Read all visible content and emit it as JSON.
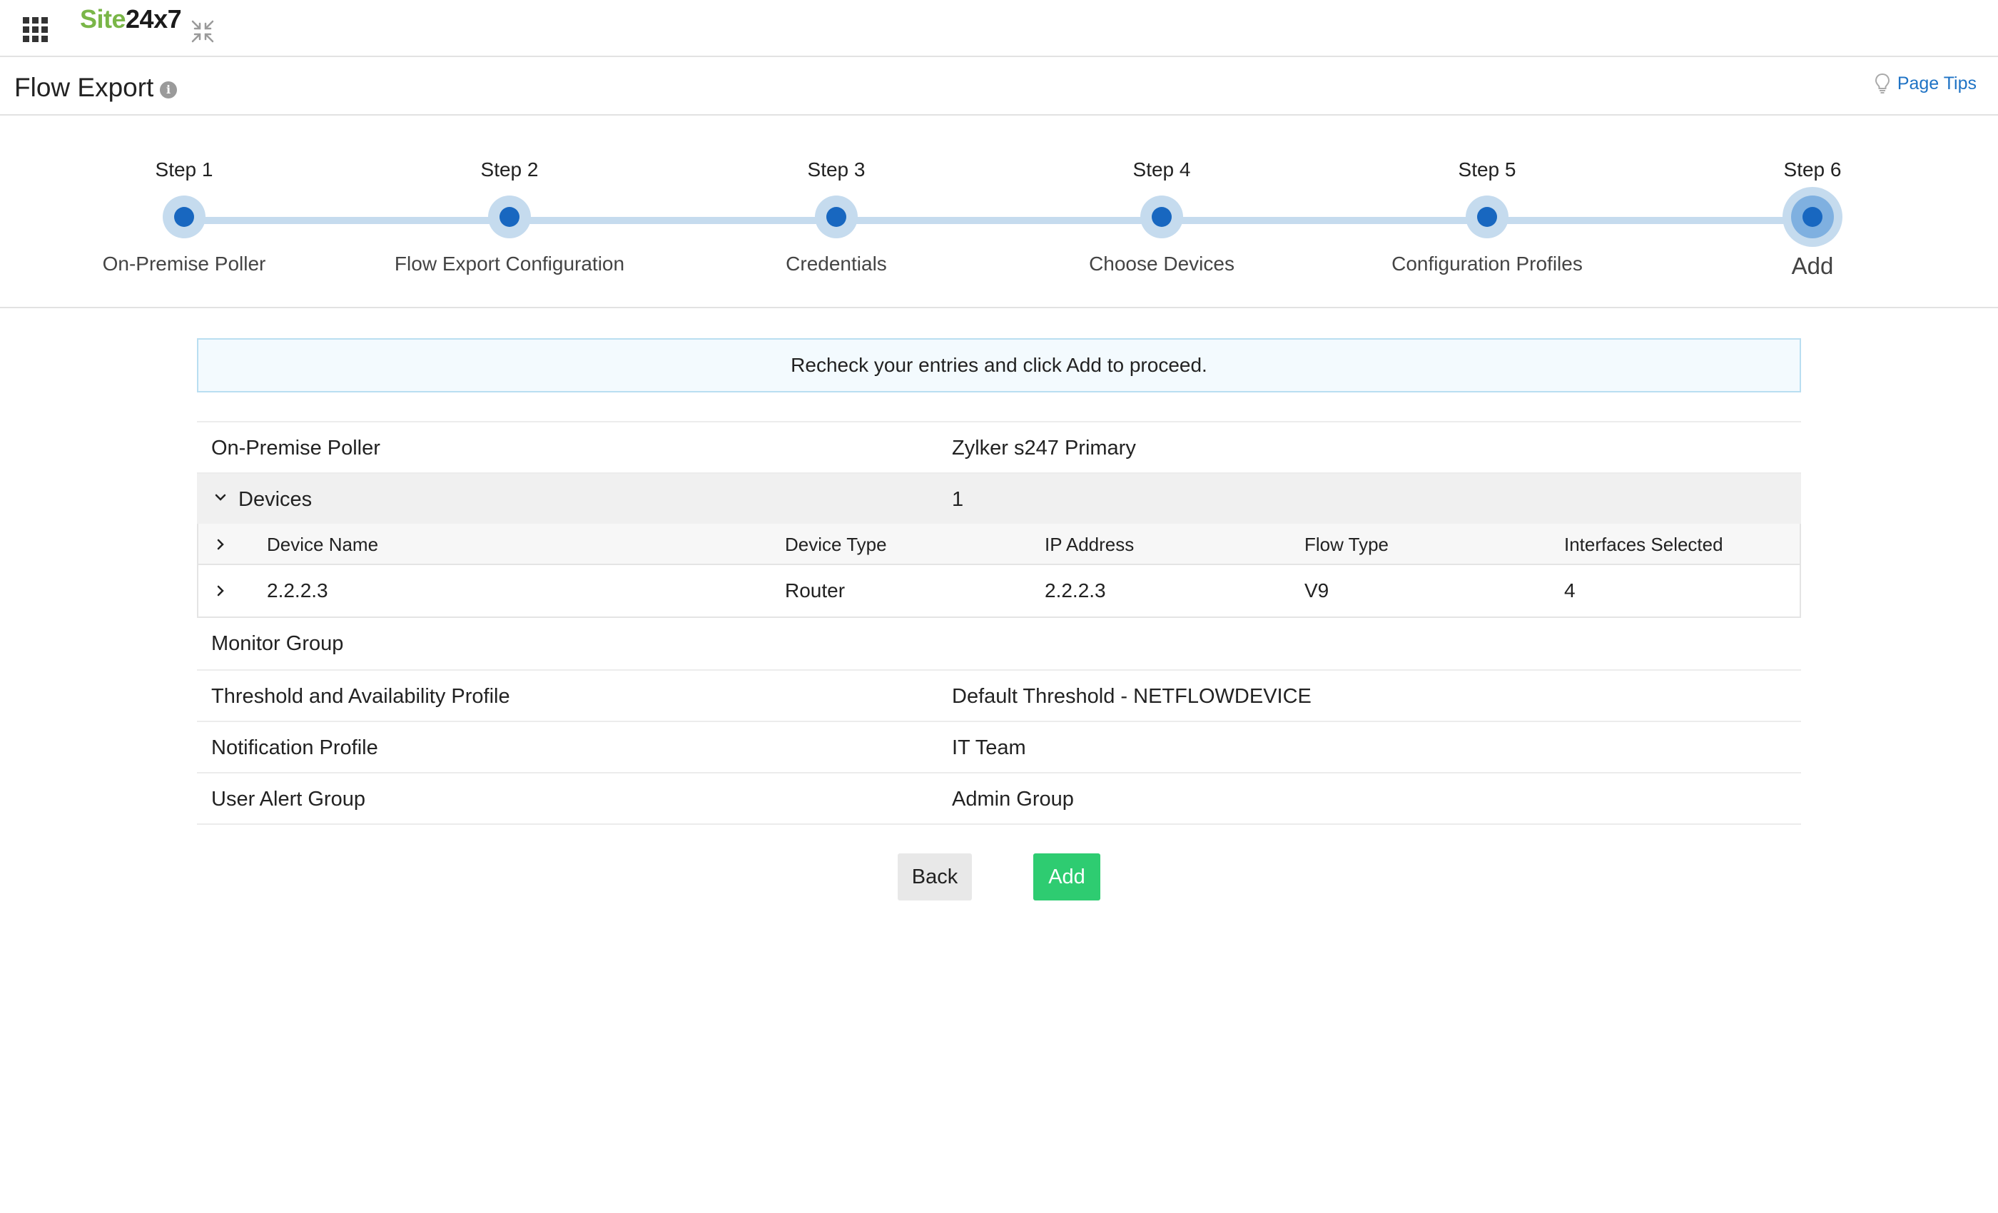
{
  "app": {
    "logo_part1": "Site",
    "logo_part2": "24x7"
  },
  "header": {
    "title": "Flow Export",
    "page_tips": "Page Tips"
  },
  "stepper": {
    "active_step": 6,
    "steps": [
      {
        "label": "Step 1",
        "name": "On-Premise Poller"
      },
      {
        "label": "Step 2",
        "name": "Flow Export Configuration"
      },
      {
        "label": "Step 3",
        "name": "Credentials"
      },
      {
        "label": "Step 4",
        "name": "Choose Devices"
      },
      {
        "label": "Step 5",
        "name": "Configuration Profiles"
      },
      {
        "label": "Step 6",
        "name": "Add"
      }
    ]
  },
  "notice": "Recheck your entries and click Add to proceed.",
  "summary": {
    "poller": {
      "label": "On-Premise Poller",
      "value": "Zylker s247 Primary"
    },
    "devices": {
      "label": "Devices",
      "value": "1"
    },
    "device_table": {
      "columns": [
        "Device Name",
        "Device Type",
        "IP Address",
        "Flow Type",
        "Interfaces Selected"
      ],
      "rows": [
        [
          "2.2.2.3",
          "Router",
          "2.2.2.3",
          "V9",
          "4"
        ]
      ]
    },
    "monitor_group": {
      "label": "Monitor Group",
      "value": ""
    },
    "threshold": {
      "label": "Threshold and Availability Profile",
      "value": "Default Threshold - NETFLOWDEVICE"
    },
    "notification": {
      "label": "Notification Profile",
      "value": "IT Team"
    },
    "user_alert": {
      "label": "User Alert Group",
      "value": "Admin Group"
    }
  },
  "buttons": {
    "back": "Back",
    "add": "Add"
  },
  "colors": {
    "brand_green": "#7ab648",
    "step_blue": "#1867c0",
    "track": "#c5dbee",
    "add_button": "#2ecc71",
    "link": "#1f73c5"
  }
}
